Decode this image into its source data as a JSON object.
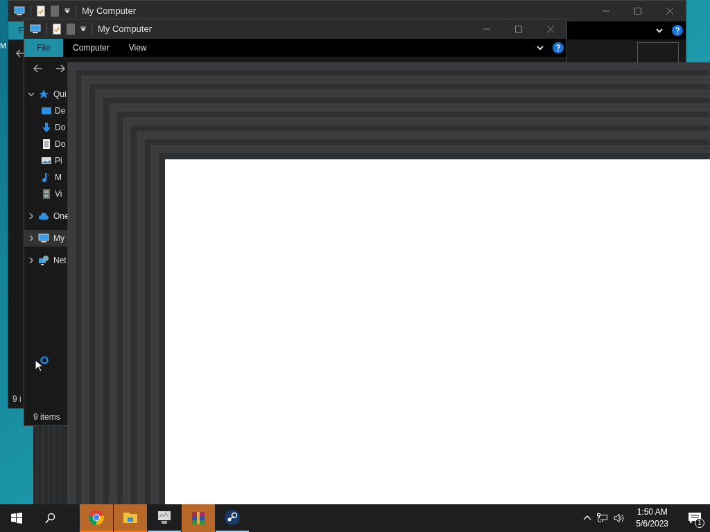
{
  "desktop": {
    "icon_label": "M"
  },
  "back_window": {
    "title": "My Computer",
    "menu_tab": {
      "label": "F",
      "selected": true
    },
    "status": "9 i"
  },
  "front_window": {
    "title": "My Computer",
    "tabs": [
      {
        "label": "File",
        "selected": true
      },
      {
        "label": "Computer",
        "selected": false
      },
      {
        "label": "View",
        "selected": false
      }
    ],
    "nav": [
      {
        "label": "Qui",
        "kind": "star",
        "expanded": true,
        "selected": false,
        "children": [
          {
            "label": "De",
            "kind": "desktop"
          },
          {
            "label": "Do",
            "kind": "download"
          },
          {
            "label": "Do",
            "kind": "document"
          },
          {
            "label": "Pi",
            "kind": "pictures"
          },
          {
            "label": "M",
            "kind": "music"
          },
          {
            "label": "Vi",
            "kind": "videos"
          }
        ]
      },
      {
        "label": "One",
        "kind": "cloud",
        "expanded": false,
        "selected": false
      },
      {
        "label": "My",
        "kind": "computer",
        "expanded": false,
        "selected": true
      },
      {
        "label": "Net",
        "kind": "network",
        "expanded": false,
        "selected": false
      }
    ],
    "status": "9 items"
  },
  "taskbar": {
    "apps": [
      {
        "kind": "chrome",
        "flashing": true,
        "running": true
      },
      {
        "kind": "folder",
        "flashing": true,
        "running": true
      },
      {
        "kind": "monitor",
        "flashing": false,
        "running": true
      },
      {
        "kind": "archive",
        "flashing": true,
        "running": false
      },
      {
        "kind": "steam",
        "flashing": false,
        "running": true
      }
    ],
    "time": "1:50 AM",
    "date": "5/6/2023",
    "notifications": "1"
  }
}
